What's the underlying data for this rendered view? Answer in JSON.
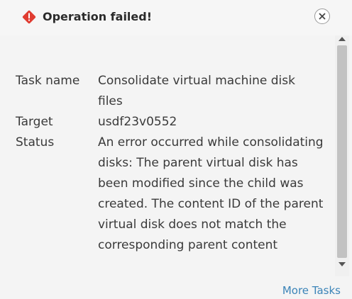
{
  "dialog": {
    "title": "Operation failed!",
    "error_icon": "error-diamond-icon",
    "close_icon": "close-icon",
    "error_color": "#e03c31"
  },
  "details": {
    "task_name_label": "Task name",
    "task_name_value": "Consolidate virtual machine disk files",
    "target_label": "Target",
    "target_value": "usdf23v0552",
    "status_label": "Status",
    "status_value": "An error occurred while consolidating disks: The parent virtual disk has been modified since the child was created. The content ID of the parent virtual disk does not match the corresponding parent content"
  },
  "footer": {
    "more_tasks_label": "More Tasks",
    "link_color": "#3b84b8"
  }
}
